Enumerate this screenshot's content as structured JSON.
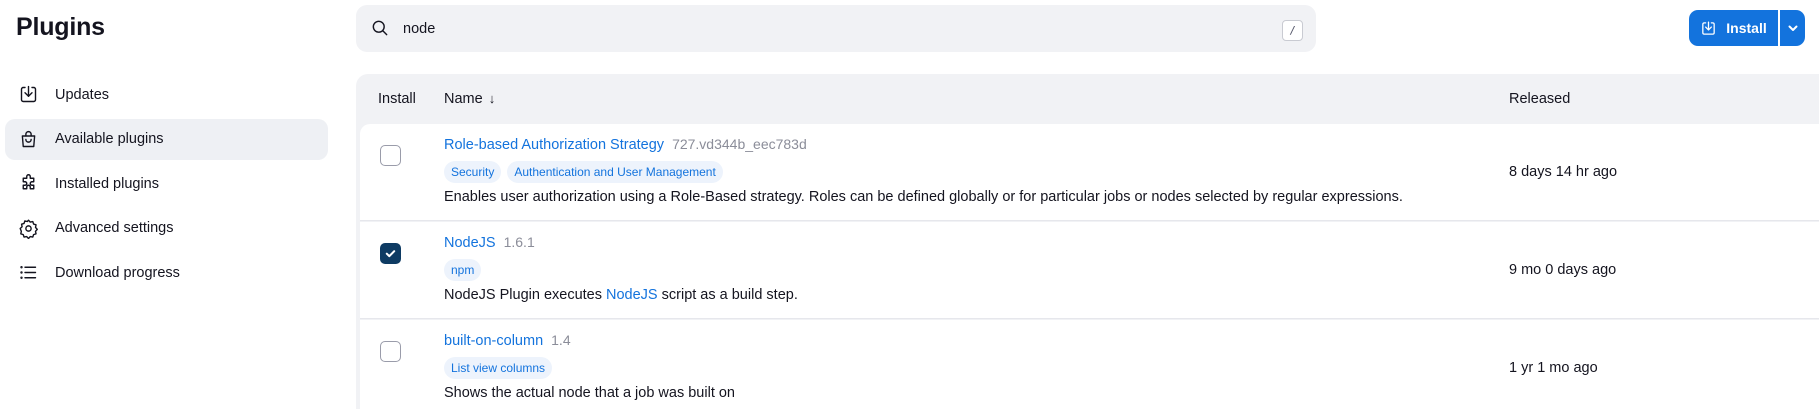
{
  "page": {
    "title": "Plugins"
  },
  "sidebar": {
    "items": [
      {
        "label": "Updates",
        "icon": "download-icon",
        "active": false
      },
      {
        "label": "Available plugins",
        "icon": "shopping-bag-icon",
        "active": true
      },
      {
        "label": "Installed plugins",
        "icon": "puzzle-icon",
        "active": false
      },
      {
        "label": "Advanced settings",
        "icon": "gear-icon",
        "active": false
      },
      {
        "label": "Download progress",
        "icon": "list-icon",
        "active": false
      }
    ]
  },
  "search": {
    "value": "node",
    "shortcut": "/",
    "placeholder": ""
  },
  "toolbar": {
    "install_label": "Install"
  },
  "table": {
    "headers": {
      "install": "Install",
      "name": "Name",
      "sort_indicator": "↓",
      "released": "Released"
    },
    "rows": [
      {
        "name": "Role-based Authorization Strategy",
        "version": "727.vd344b_eec783d",
        "tags": [
          "Security",
          "Authentication and User Management"
        ],
        "description": "Enables user authorization using a Role-Based strategy. Roles can be defined globally or for particular jobs or nodes selected by regular expressions.",
        "released": "8 days 14 hr ago",
        "checked": false
      },
      {
        "name": "NodeJS",
        "version": "1.6.1",
        "tags": [
          "npm"
        ],
        "description_before": "NodeJS Plugin executes ",
        "description_link": "NodeJS",
        "description_after": " script as a build step.",
        "released": "9 mo 0 days ago",
        "checked": true
      },
      {
        "name": "built-on-column",
        "version": "1.4",
        "tags": [
          "List view columns"
        ],
        "description": "Shows the actual node that a job was built on",
        "released": "1 yr 1 mo ago",
        "checked": false
      }
    ]
  },
  "colors": {
    "accent": "#1373dd",
    "checkbox_checked": "#0e3b63",
    "table_bg": "#f1f2f5",
    "tag_bg": "#edf3fc"
  }
}
